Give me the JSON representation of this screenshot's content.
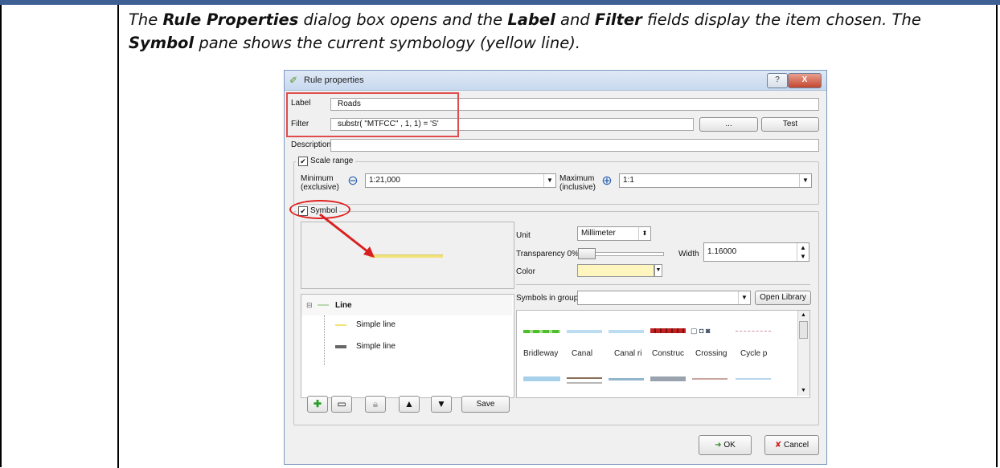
{
  "instruction": {
    "p1": "The ",
    "b1": "Rule Properties",
    "p2": " dialog box opens and the ",
    "b2": "Label",
    "p3": " and ",
    "b3": "Filter",
    "p4": " fields display the item chosen. The ",
    "b4": "Symbol",
    "p5": " pane shows the current symbology (yellow line)."
  },
  "dialog": {
    "title": "Rule properties",
    "help_label": "?",
    "close_label": "X",
    "label_label": "Label",
    "label_value": "Roads",
    "filter_label": "Filter",
    "filter_value": "substr( \"MTFCC\" , 1, 1) = 'S'",
    "ellipsis_label": "...",
    "test_label": "Test",
    "description_label": "Description",
    "description_value": "",
    "scale": {
      "title": "Scale range",
      "min_label": "Minimum",
      "min_sub": "(exclusive)",
      "min_value": "1:21,000",
      "max_label": "Maximum",
      "max_sub": "(inclusive)",
      "max_value": "1:1"
    },
    "symbol": {
      "title": "Symbol",
      "unit_label": "Unit",
      "unit_value": "Millimeter",
      "transparency_label": "Transparency 0%",
      "transparency_level": 0.05,
      "width_label": "Width",
      "width_value": "1.16000",
      "color_label": "Color",
      "color_value": "#fff5bf",
      "symbols_in_group_label": "Symbols in group",
      "symbols_in_group_value": "",
      "open_library_label": "Open Library",
      "tree": {
        "root": "Line",
        "children": [
          "Simple line",
          "Simple line"
        ]
      },
      "library_names": [
        "Bridleway",
        "Canal",
        "Canal ri",
        "Construc",
        "Crossing",
        "Cycle p"
      ],
      "save_label": "Save"
    },
    "ok_label": "OK",
    "cancel_label": "Cancel"
  },
  "colors": {
    "highlight": "#e04b4b",
    "yellow_line": "#f2e27a",
    "top_band": "#3d5f94"
  }
}
